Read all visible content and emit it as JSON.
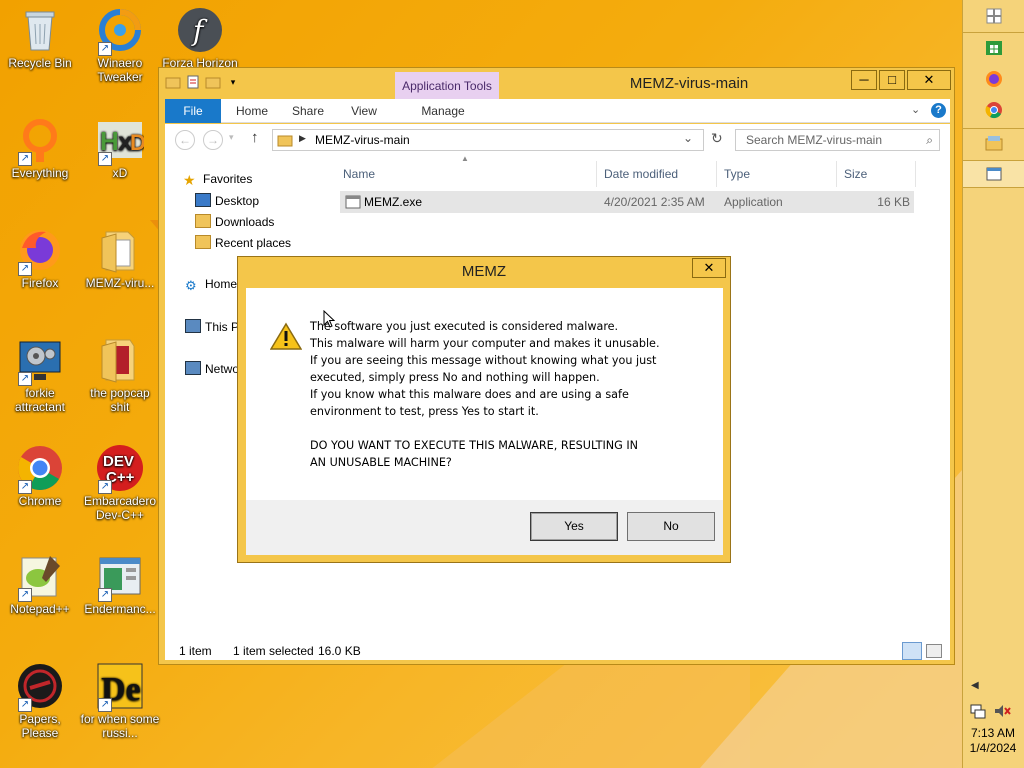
{
  "desktop": {
    "icons": [
      {
        "label": "Recycle Bin"
      },
      {
        "label": "Winaero Tweaker"
      },
      {
        "label": "Forza Horizon"
      },
      {
        "label": "Everything"
      },
      {
        "label": "xD"
      },
      {
        "label": "Firefox"
      },
      {
        "label": "MEMZ-viru..."
      },
      {
        "label": "forkie attractant"
      },
      {
        "label": "the popcap shit"
      },
      {
        "label": "Chrome"
      },
      {
        "label": "Embarcadero Dev-C++"
      },
      {
        "label": "Notepad++"
      },
      {
        "label": "Endermanc..."
      },
      {
        "label": "Papers, Please"
      },
      {
        "label": "for when some russi..."
      }
    ]
  },
  "explorer": {
    "title": "MEMZ-virus-main",
    "contextual_tab_group": "Application Tools",
    "ribbon_tabs": [
      "File",
      "Home",
      "Share",
      "View",
      "Manage"
    ],
    "address_path": "MEMZ-virus-main",
    "search_placeholder": "Search MEMZ-virus-main",
    "nav": {
      "favorites": "Favorites",
      "desktop": "Desktop",
      "downloads": "Downloads",
      "recent": "Recent places",
      "homegroup": "Home",
      "thispc": "This P",
      "network": "Netwo"
    },
    "columns": [
      "Name",
      "Date modified",
      "Type",
      "Size"
    ],
    "files": [
      {
        "name": "MEMZ.exe",
        "date": "4/20/2021 2:35 AM",
        "type": "Application",
        "size": "16 KB"
      }
    ],
    "status": {
      "count": "1 item",
      "selected": "1 item selected",
      "size": "16.0 KB"
    }
  },
  "dialog": {
    "title": "MEMZ",
    "lines": [
      "The software you just executed is considered malware.",
      "This malware will harm your computer and makes it unusable.",
      "If you are seeing this message without knowing what you just",
      "executed, simply press No and nothing will happen.",
      "If you know what this malware does and are using a safe",
      "environment to test, press Yes to start it."
    ],
    "question_lines": [
      "DO YOU WANT TO EXECUTE THIS MALWARE, RESULTING IN",
      "AN UNUSABLE MACHINE?"
    ],
    "yes_label": "Yes",
    "no_label": "No"
  },
  "taskbar": {
    "time": "7:13 AM",
    "date": "1/4/2024"
  },
  "colors": {
    "accent_file_tab": "#1979ca",
    "window_frame": "#f4c64a",
    "desktop": "#f2a100"
  }
}
